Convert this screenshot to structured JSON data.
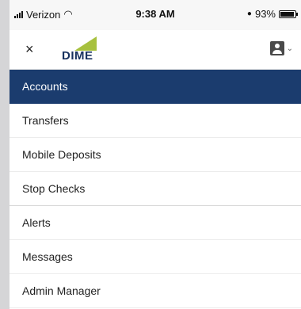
{
  "status_bar": {
    "carrier": "Verizon",
    "time": "9:38 AM",
    "battery": "93%",
    "battery_level": 0.93
  },
  "header": {
    "close": "×",
    "logo_text": "DIME",
    "colors": {
      "brand_navy": "#18325f",
      "brand_green": "#a7c13e"
    }
  },
  "menu": {
    "items": [
      {
        "label": "Accounts"
      },
      {
        "label": "Transfers"
      },
      {
        "label": "Mobile Deposits"
      },
      {
        "label": "Stop Checks"
      },
      {
        "label": "Alerts"
      },
      {
        "label": "Messages"
      },
      {
        "label": "Admin Manager"
      }
    ],
    "active_color": "#1b3c6e"
  }
}
